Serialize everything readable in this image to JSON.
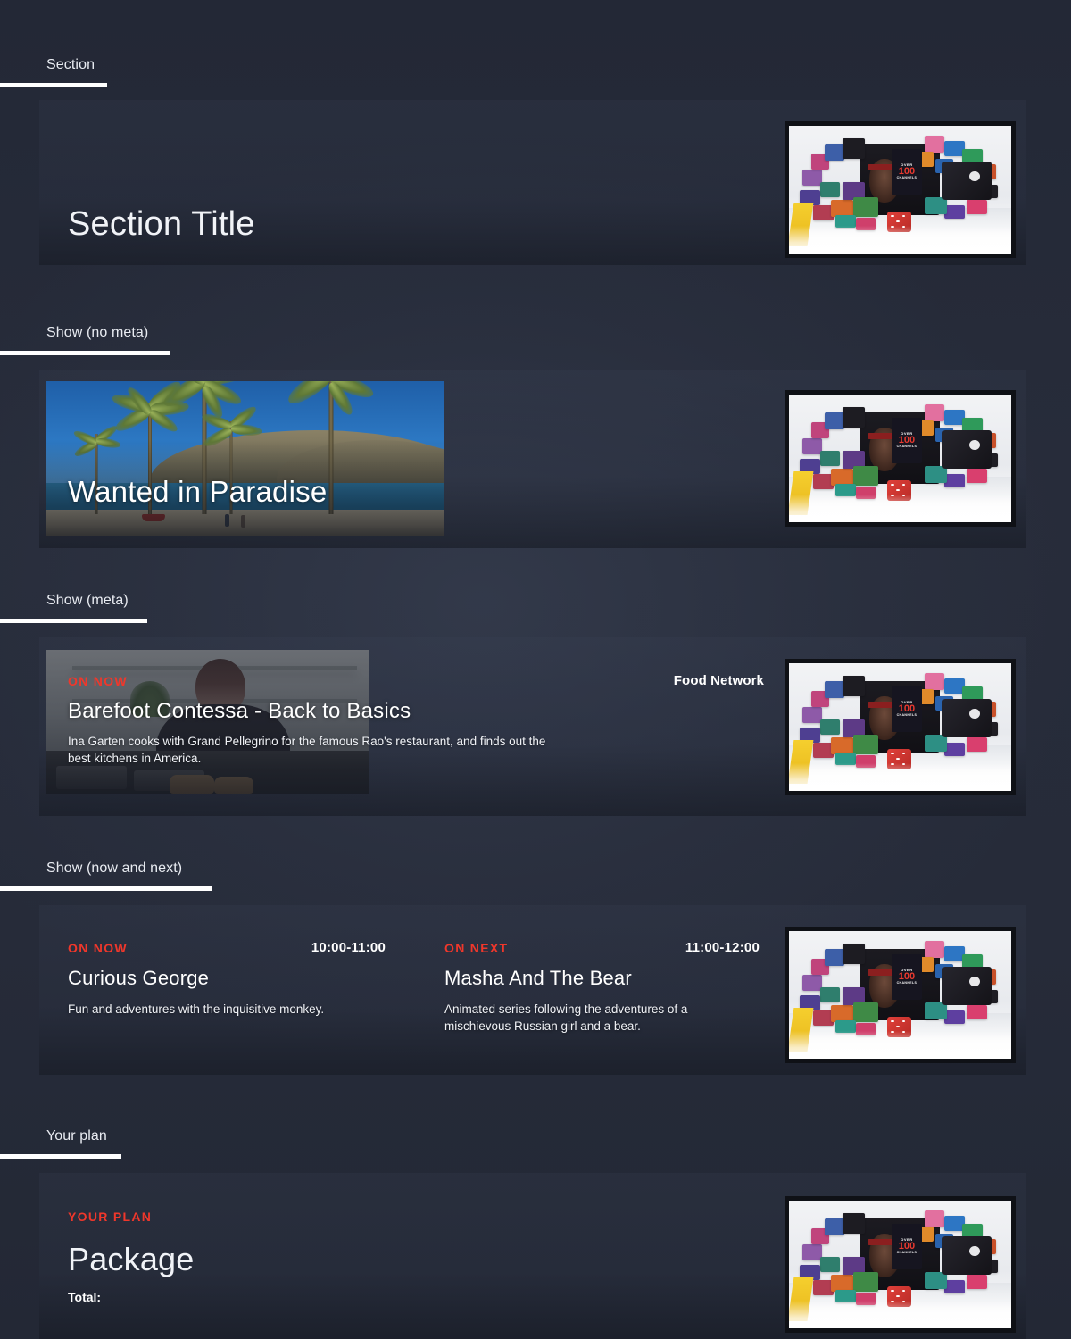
{
  "page": {
    "background_color": "#252a38",
    "accent_color": "#f0372b",
    "rule_color": "#ffffff"
  },
  "sections": [
    {
      "label": "Section",
      "title": "Section Title"
    },
    {
      "label": "Show (no meta)",
      "show_title": "Wanted in Paradise"
    },
    {
      "label": "Show (meta)",
      "flag": "ON NOW",
      "show_title": "Barefoot Contessa - Back to Basics",
      "description": "Ina Garten cooks with Grand Pellegrino for the famous Rao's restaurant, and finds out the best kitchens in America.",
      "channel": "Food Network"
    },
    {
      "label": "Show (now and next)",
      "now": {
        "flag": "ON NOW",
        "time": "10:00-11:00",
        "title": "Curious George",
        "description": "Fun and adventures with the inquisitive monkey."
      },
      "next": {
        "flag": "ON NEXT",
        "time": "11:00-12:00",
        "title": "Masha And The Bear",
        "description": "Animated series following the adventures of a mischievous Russian girl and a bear."
      }
    },
    {
      "label": "Your plan",
      "flag": "YOUR PLAN",
      "title": "Package",
      "total_label": "Total:"
    }
  ],
  "promo_image": {
    "over_label": "OVER",
    "count": "100",
    "channels_label": "CHANNELS"
  }
}
